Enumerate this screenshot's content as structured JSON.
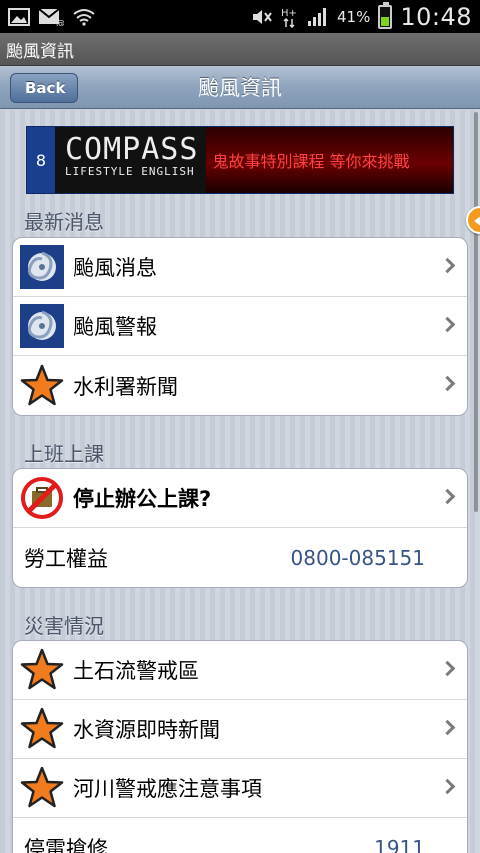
{
  "status_bar": {
    "battery_pct": "41%",
    "battery_level": 0.41,
    "time": "10:48",
    "icons": [
      "gallery-icon",
      "mail-icon",
      "wifi-icon",
      "mute-icon",
      "hplus-data-icon",
      "signal-icon",
      "battery-icon"
    ]
  },
  "app_title": "颱風資訊",
  "nav": {
    "back_label": "Back",
    "title": "颱風資訊"
  },
  "banner": {
    "badge": "8",
    "brand": "COMPASS",
    "brand_sub": "LIFESTYLE ENGLISH",
    "slogan": "鬼故事特別課程 等你來挑戰"
  },
  "sections": [
    {
      "header": "最新消息",
      "items": [
        {
          "label": "颱風消息",
          "icon": "typhoon-satellite-icon"
        },
        {
          "label": "颱風警報",
          "icon": "typhoon-satellite-icon"
        },
        {
          "label": "水利署新聞",
          "icon": "star-icon"
        }
      ]
    },
    {
      "header": "上班上課",
      "items": [
        {
          "label": "停止辦公上課?",
          "icon": "no-work-icon"
        },
        {
          "label": "勞工權益",
          "value": "0800-085151"
        }
      ]
    },
    {
      "header": "災害情況",
      "items": [
        {
          "label": "土石流警戒區",
          "icon": "star-icon"
        },
        {
          "label": "水資源即時新聞",
          "icon": "star-icon"
        },
        {
          "label": "河川警戒應注意事項",
          "icon": "star-icon"
        },
        {
          "label": "停電搶修",
          "value": "1911"
        }
      ]
    }
  ],
  "colors": {
    "nav_blue": "#8ea3bc",
    "value_blue": "#385487",
    "star_orange": "#f07c1e"
  }
}
